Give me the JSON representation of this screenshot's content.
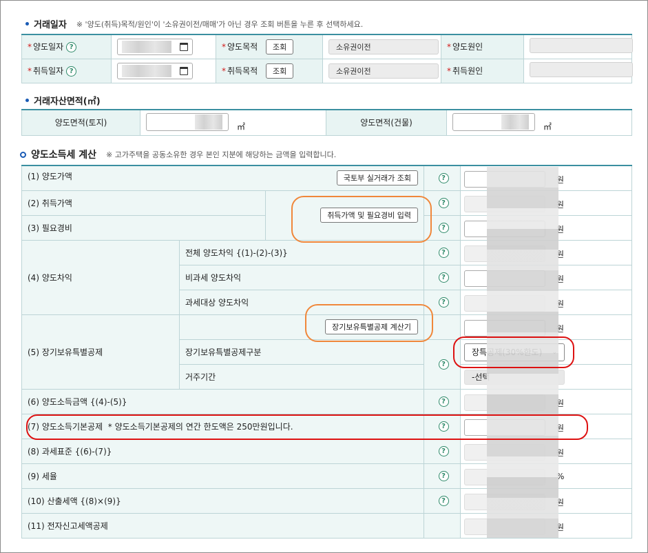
{
  "section1": {
    "title": "거래일자",
    "note": "※ '양도(취득)목적/원인'이 '소유권이전/매매'가 아닌 경우 조회 버튼을 누른 후 선택하세요.",
    "row1": {
      "date_label": "양도일자",
      "purpose_label": "양도목적",
      "lookup": "조회",
      "purpose_value": "소유권이전",
      "cause_label": "양도원인"
    },
    "row2": {
      "date_label": "취득일자",
      "purpose_label": "취득목적",
      "lookup": "조회",
      "purpose_value": "소유권이전",
      "cause_label": "취득원인"
    }
  },
  "section2": {
    "title": "거래자산면적(㎡)",
    "land_label": "양도면적(토지)",
    "bldg_label": "양도면적(건물)",
    "unit": "㎡"
  },
  "section3": {
    "title": "양도소득세 계산",
    "note": "※ 고가주택을 공동소유한 경우 본인 지분에 해당하는 금액을 입력합니다.",
    "help": "?",
    "unit_won": "원",
    "unit_pct": "%",
    "btn_molit": "국토부 실거래가 조회",
    "btn_acq": "취득가액 및 필요경비 입력",
    "btn_ltd": "장기보유특별공제 계산기",
    "rows": {
      "r1": "(1) 양도가액",
      "r2": "(2) 취득가액",
      "r3": "(3) 필요경비",
      "r4": "(4) 양도차익",
      "r4a": "전체 양도차익 {(1)-(2)-(3)}",
      "r4b": "비과세 양도차익",
      "r4c": "과세대상 양도차익",
      "r5": "(5) 장기보유특별공제",
      "r5b": "장기보유특별공제구분",
      "r5c": "거주기간",
      "r6": "(6) 양도소득금액 {(4)-(5)}",
      "r7": "(7) 양도소득기본공제",
      "r7note": "* 양도소득기본공제의 연간 한도액은 250만원입니다.",
      "r8": "(8) 과세표준 {(6)-(7)}",
      "r9": "(9) 세율",
      "r10": "(10) 산출세액 {(8)×(9)}",
      "r11": "(11) 전자신고세액공제"
    },
    "ltd_select": "장특공제(30%한도)",
    "residence_select": "-선택"
  }
}
